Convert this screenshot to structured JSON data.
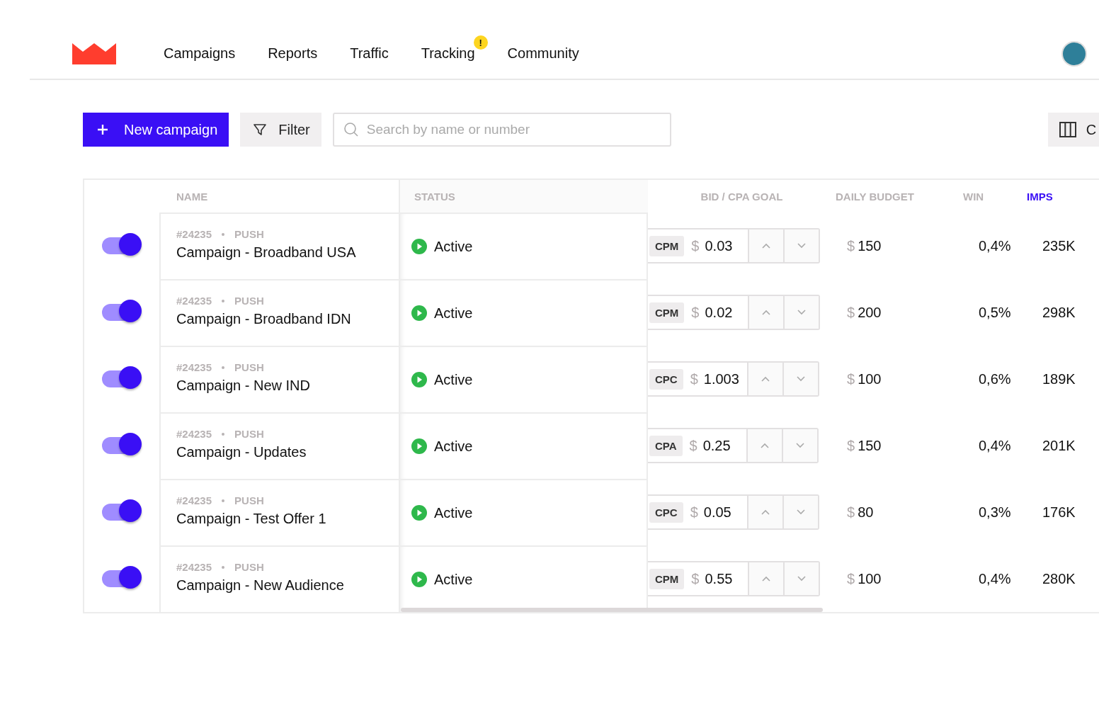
{
  "nav": {
    "items": [
      {
        "label": "Campaigns"
      },
      {
        "label": "Reports"
      },
      {
        "label": "Traffic"
      },
      {
        "label": "Tracking",
        "badge": "!"
      },
      {
        "label": "Community"
      }
    ]
  },
  "toolbar": {
    "new_button": "New campaign",
    "filter_button": "Filter",
    "search": {
      "placeholder": "Search by name or number"
    },
    "columns_button": "C"
  },
  "table": {
    "columns": [
      {
        "label": "NAME",
        "selected": false
      },
      {
        "label": "STATUS",
        "selected": false
      },
      {
        "label": "BID / CPA GOAL",
        "selected": false
      },
      {
        "label": "DAILY BUDGET",
        "selected": false
      },
      {
        "label": "WIN",
        "selected": false
      },
      {
        "label": "IMPS",
        "selected": true
      }
    ],
    "rows": [
      {
        "on": true,
        "id": "#24235",
        "type": "PUSH",
        "name": "Campaign - Broadband USA",
        "status": "Active",
        "bid_type": "CPM",
        "currency": "$",
        "bid": "0.03",
        "budget_currency": "$",
        "budget": "150",
        "win": "0,4%",
        "imps": "235K"
      },
      {
        "on": true,
        "id": "#24235",
        "type": "PUSH",
        "name": "Campaign - Broadband IDN",
        "status": "Active",
        "bid_type": "CPM",
        "currency": "$",
        "bid": "0.02",
        "budget_currency": "$",
        "budget": "200",
        "win": "0,5%",
        "imps": "298K"
      },
      {
        "on": true,
        "id": "#24235",
        "type": "PUSH",
        "name": "Campaign - New IND",
        "status": "Active",
        "bid_type": "CPC",
        "currency": "$",
        "bid": "1.003",
        "budget_currency": "$",
        "budget": "100",
        "win": "0,6%",
        "imps": "189K"
      },
      {
        "on": true,
        "id": "#24235",
        "type": "PUSH",
        "name": "Campaign - Updates",
        "status": "Active",
        "bid_type": "CPA",
        "currency": "$",
        "bid": "0.25",
        "budget_currency": "$",
        "budget": "150",
        "win": "0,4%",
        "imps": "201K"
      },
      {
        "on": true,
        "id": "#24235",
        "type": "PUSH",
        "name": "Campaign - Test Offer 1",
        "status": "Active",
        "bid_type": "CPC",
        "currency": "$",
        "bid": "0.05",
        "budget_currency": "$",
        "budget": "80",
        "win": "0,3%",
        "imps": "176K"
      },
      {
        "on": true,
        "id": "#24235",
        "type": "PUSH",
        "name": "Campaign - New Audience",
        "status": "Active",
        "bid_type": "CPM",
        "currency": "$",
        "bid": "0.55",
        "budget_currency": "$",
        "budget": "100",
        "win": "0,4%",
        "imps": "280K"
      }
    ]
  }
}
